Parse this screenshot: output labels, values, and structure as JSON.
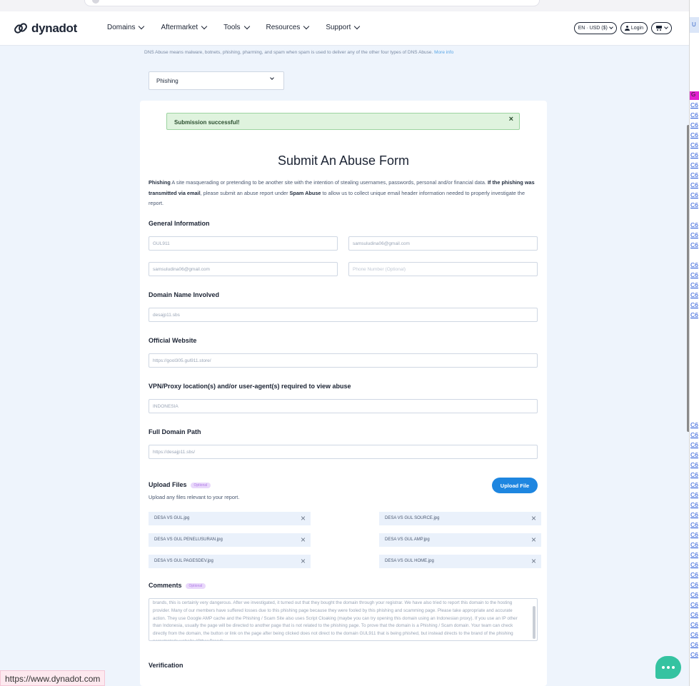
{
  "header": {
    "logo_text": "dynadot",
    "nav": [
      "Domains",
      "Aftermarket",
      "Tools",
      "Resources",
      "Support"
    ],
    "currency": "EN · USD ($)",
    "login": "Login"
  },
  "notice": {
    "text": "DNS Abuse means malware, botnets, phishing, pharming, and spam when spam is used to deliver any of the other four types of DNS Abuse.",
    "link": "More info"
  },
  "abuse_type": "Phishing",
  "alert": "Submission successful!",
  "form": {
    "title": "Submit An Abuse Form",
    "intro_term": "Phishing",
    "intro_1": " A site masquerading or pretending to be another site with the intention of stealing usernames, passwords, personal and/or financial data. ",
    "intro_bold": "If the phishing was transmitted via email",
    "intro_2": ", please submit an abuse report under ",
    "intro_spam": "Spam Abuse",
    "intro_3": " to allow us to collect unique email header information needed to properly investigate the report.",
    "general_info": "General Information",
    "name_value": "GUL911",
    "email_value": "samsuludina06@gmail.com",
    "email_confirm_value": "samsuludina06@gmail.com",
    "phone_placeholder": "Phone Number (Optional)",
    "domain_label": "Domain Name Involved",
    "domain_value": "desajp11.sbs",
    "website_label": "Official Website",
    "website_value": "https://gool305.gul911.store/",
    "vpn_label": "VPN/Proxy location(s) and/or user-agent(s) required to view abuse",
    "vpn_value": "INDONESIA",
    "path_label": "Full Domain Path",
    "path_value": "https://desajp11.sbs/",
    "upload_label": "Upload Files",
    "optional": "Optional",
    "upload_sub": "Upload any files relevant to your report.",
    "upload_button": "Upload File",
    "files": [
      "DESA VS GUL.jpg",
      "DESA VS GUL SOURCE.jpg",
      "DESA VS GUL PENELUSURAN.jpg",
      "DESA VS GUL AMP.jpg",
      "DESA VS GUL PAGESDEV.jpg",
      "DESA VS GUL HOME.jpg"
    ],
    "comments_label": "Comments",
    "comments_text": "brands, this is certainly very dangerous. After we investigated, it turned out that they bought the domain through your registrar. We have also tried to report this domain to the hosting provider. Many of our members have suffered losses due to this phishing page because they were fooled by this phishing and scamming page. Please take appropriate and accurate action. They use Google AMP cache and the Phishing / Scam Site also uses Script Cloaking (maybe you can try opening this domain using an Indonesian proxy). If you use an IP other than Indonesia, usually the page will be directed to another page that is not related to the phishing page. To prove that the domain is a Phishing / Scam domain. Your team can check directly from the domain, the button or link on the page after being clicked does not direct to the domain GUL911 that is being phished, but instead directs to the brand of the phishing perpetrator's website (Other Brand).",
    "verification_label": "Verification"
  },
  "side_panel": {
    "top": "U",
    "highlight": "G",
    "link_text": "C6"
  },
  "status_url": "https://www.dynadot.com",
  "colors": {
    "accent": "#1e86e0",
    "success_bg": "#dff3de",
    "chat": "#35c3a1"
  }
}
